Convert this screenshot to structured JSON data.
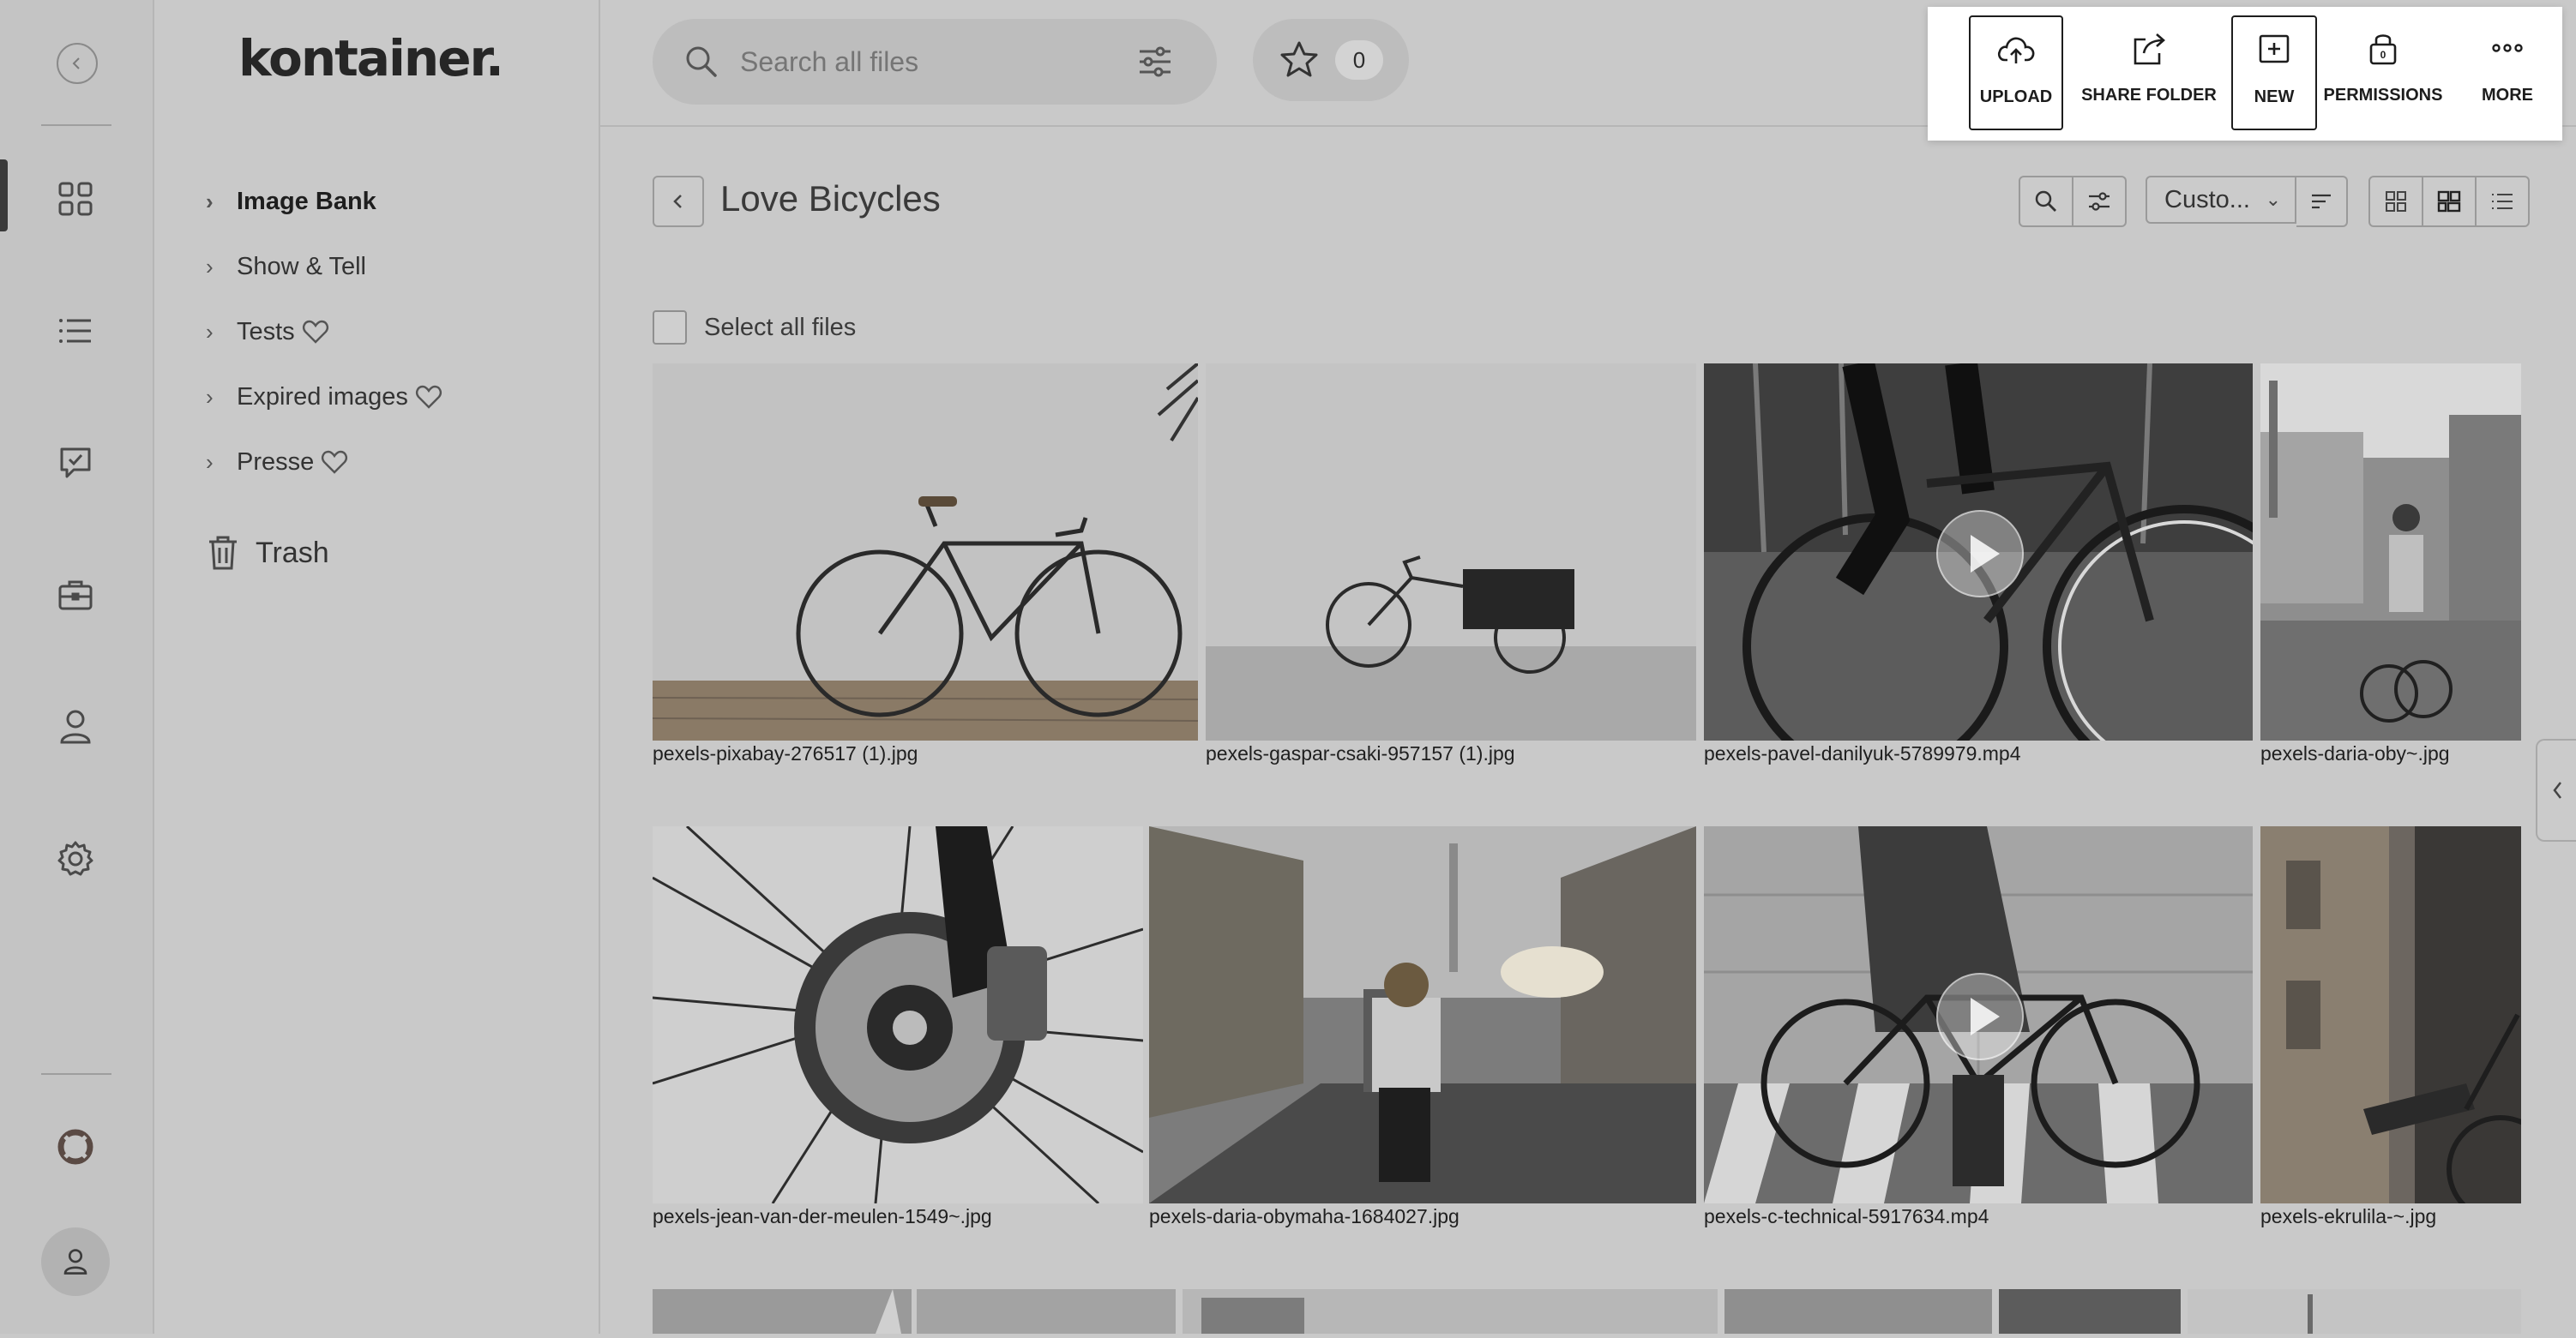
{
  "brand": {
    "logo": "kontainer."
  },
  "sidebar": {
    "tree": [
      {
        "label": "Image Bank",
        "bold": true,
        "favorite": false
      },
      {
        "label": "Show & Tell",
        "bold": false,
        "favorite": false
      },
      {
        "label": "Tests",
        "bold": false,
        "favorite": true
      },
      {
        "label": "Expired images",
        "bold": false,
        "favorite": true
      },
      {
        "label": "Presse",
        "bold": false,
        "favorite": true
      }
    ],
    "trash_label": "Trash"
  },
  "topbar": {
    "search_placeholder": "Search all files",
    "favorites_count": "0",
    "actions": {
      "upload": "UPLOAD",
      "share_folder": "SHARE FOLDER",
      "new": "NEW",
      "permissions": "PERMISSIONS",
      "permissions_badge": "0",
      "more": "MORE"
    }
  },
  "main": {
    "folder_title": "Love Bicycles",
    "sort_value": "Custo...",
    "select_all_label": "Select all files",
    "files": [
      {
        "name": "pexels-pixabay-276517 (1).jpg",
        "type": "image"
      },
      {
        "name": "pexels-gaspar-csaki-957157 (1).jpg",
        "type": "image"
      },
      {
        "name": "pexels-pavel-danilyuk-5789979.mp4",
        "type": "video"
      },
      {
        "name": "pexels-daria-oby~.jpg",
        "type": "image"
      },
      {
        "name": "pexels-jean-van-der-meulen-1549~.jpg",
        "type": "image"
      },
      {
        "name": "pexels-daria-obymaha-1684027.jpg",
        "type": "image"
      },
      {
        "name": "pexels-c-technical-5917634.mp4",
        "type": "video"
      },
      {
        "name": "pexels-ekrulila-~.jpg",
        "type": "image"
      }
    ]
  },
  "colors": {
    "overlay_gray": "#c9c9c9",
    "action_panel_bg": "#ffffff",
    "text_dark": "#1d1d1d"
  }
}
